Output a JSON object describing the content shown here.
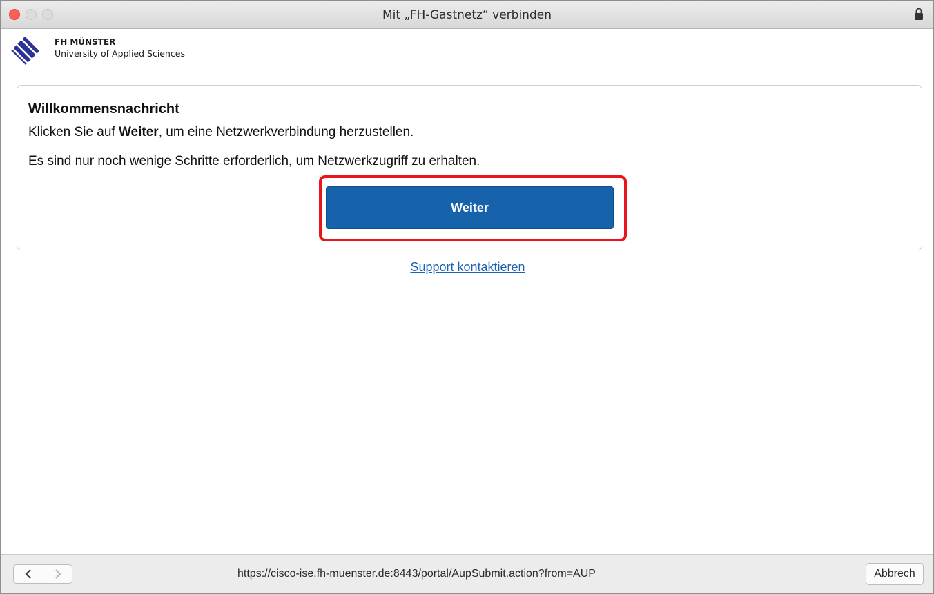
{
  "window": {
    "title": "Mit „FH-Gastnetz“ verbinden"
  },
  "brand": {
    "name": "FH MÜNSTER",
    "subtitle": "University of Applied Sciences",
    "logo_icon": "fh-muenster-logo",
    "color": "#2b3399"
  },
  "card": {
    "title": "Willkommensnachricht",
    "line1_prefix": "Klicken Sie auf ",
    "line1_bold": "Weiter",
    "line1_suffix": ", um eine Netzwerkverbindung herzustellen.",
    "line2": "Es sind nur noch wenige Schritte erforderlich, um Netzwerkzugriff zu erhalten.",
    "button_label": "Weiter"
  },
  "support_link": "Support kontaktieren",
  "footer": {
    "back_icon": "chevron-left-icon",
    "forward_icon": "chevron-right-icon",
    "url": "https://cisco-ise.fh-muenster.de:8443/portal/AupSubmit.action?from=AUP",
    "cancel_label": "Abbrech"
  },
  "colors": {
    "button": "#1763ab",
    "highlight": "#e8161b",
    "link": "#1b62b8",
    "close": "#fc5f57"
  }
}
